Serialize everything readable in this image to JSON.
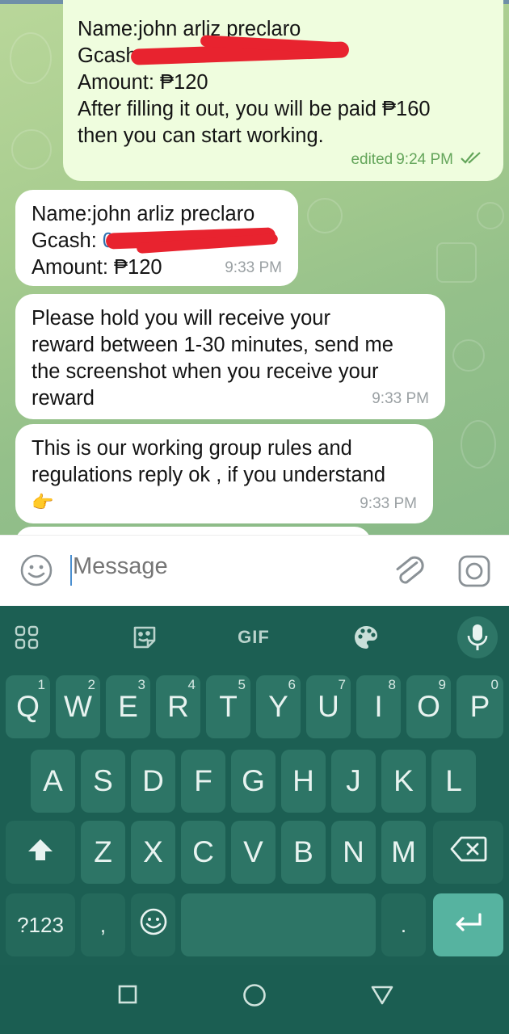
{
  "messages": [
    {
      "direction": "outgoing",
      "lines": [
        "Name:john arliz preclaro",
        "Gcash",
        "Amount:  ₱120",
        "After filling it out, you will be paid ₱160",
        "then you can start working."
      ],
      "meta_edited": "edited",
      "time": "9:24 PM",
      "status_icon": "double-check-icon"
    },
    {
      "direction": "incoming",
      "lines": [
        "Name:john arliz preclaro",
        "Gcash: ",
        "Amount:  ₱120"
      ],
      "time": "9:33 PM"
    },
    {
      "direction": "incoming",
      "lines": [
        "Please hold you will receive your",
        "reward between 1-30 minutes, send me",
        "the screenshot when you receive your",
        "reward"
      ],
      "time": "9:33 PM"
    },
    {
      "direction": "incoming",
      "lines": [
        "This is our working group rules and",
        "regulations reply ok , if you understand",
        "👉"
      ],
      "time": "9:33 PM"
    }
  ],
  "input": {
    "placeholder": "Message",
    "left_icon": "emoji-icon",
    "right_icons": [
      "attach-icon",
      "camera-icon"
    ]
  },
  "keyboard": {
    "toolbar": [
      "apps-grid-icon",
      "sticker-icon",
      "GIF",
      "palette-icon",
      "mic-icon"
    ],
    "gif_label": "GIF",
    "row1": [
      {
        "k": "Q",
        "n": "1"
      },
      {
        "k": "W",
        "n": "2"
      },
      {
        "k": "E",
        "n": "3"
      },
      {
        "k": "R",
        "n": "4"
      },
      {
        "k": "T",
        "n": "5"
      },
      {
        "k": "Y",
        "n": "6"
      },
      {
        "k": "U",
        "n": "7"
      },
      {
        "k": "I",
        "n": "8"
      },
      {
        "k": "O",
        "n": "9"
      },
      {
        "k": "P",
        "n": "0"
      }
    ],
    "row2": [
      "A",
      "S",
      "D",
      "F",
      "G",
      "H",
      "J",
      "K",
      "L"
    ],
    "row3": [
      "Z",
      "X",
      "C",
      "V",
      "B",
      "N",
      "M"
    ],
    "symbols_label": "?123",
    "comma_label": ",",
    "period_label": ".",
    "shift_icon": "shift-icon",
    "backspace_icon": "backspace-icon",
    "enter_icon": "enter-icon",
    "keyboard_emoji_icon": "emoji-icon"
  },
  "navbar": [
    "recents-square-icon",
    "home-circle-icon",
    "back-triangle-icon"
  ],
  "colors": {
    "outgoing_bubble": "#effdde",
    "incoming_bubble": "#ffffff",
    "keyboard_bg": "#1c5f53",
    "key_bg": "#2d7566",
    "enter_key": "#56b3a0",
    "check_color": "#63a55a"
  }
}
